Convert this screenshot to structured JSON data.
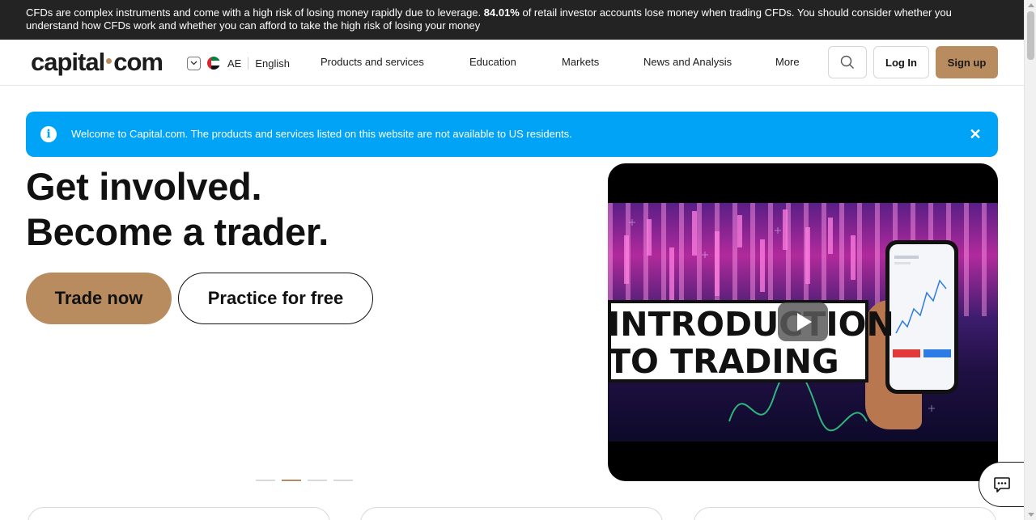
{
  "risk_banner": {
    "text_before": "CFDs are complex instruments and come with a high risk of losing money rapidly due to leverage. ",
    "percent": "84.01%",
    "text_after": " of retail investor accounts lose money when trading CFDs. You should consider whether you understand how CFDs work and whether you can afford to take the high risk of losing your money"
  },
  "header": {
    "logo_left": "capital",
    "logo_right": "com",
    "region_code": "AE",
    "language": "English",
    "nav": [
      "Products and services",
      "Education",
      "Markets",
      "News and Analysis",
      "More"
    ],
    "login_label": "Log In",
    "signup_label": "Sign up"
  },
  "alert": {
    "message": "Welcome to Capital.com. The products and services listed on this website are not available to US residents.",
    "close_glyph": "✕"
  },
  "hero": {
    "title_line1": "Get involved.",
    "title_line2": "Become a trader.",
    "primary_cta": "Trade now",
    "secondary_cta": "Practice for free",
    "slides": 4,
    "active_slide": 2
  },
  "video": {
    "line1": "INTRODUCTION",
    "line2": "TO TRADING"
  },
  "colors": {
    "brand": "#b98c5f",
    "info": "#00a3f5",
    "banner_bg": "#232323"
  },
  "icons": [
    "chevron-down-icon",
    "flag-icon",
    "search-icon",
    "info-icon",
    "close-icon",
    "play-icon",
    "chat-icon"
  ]
}
